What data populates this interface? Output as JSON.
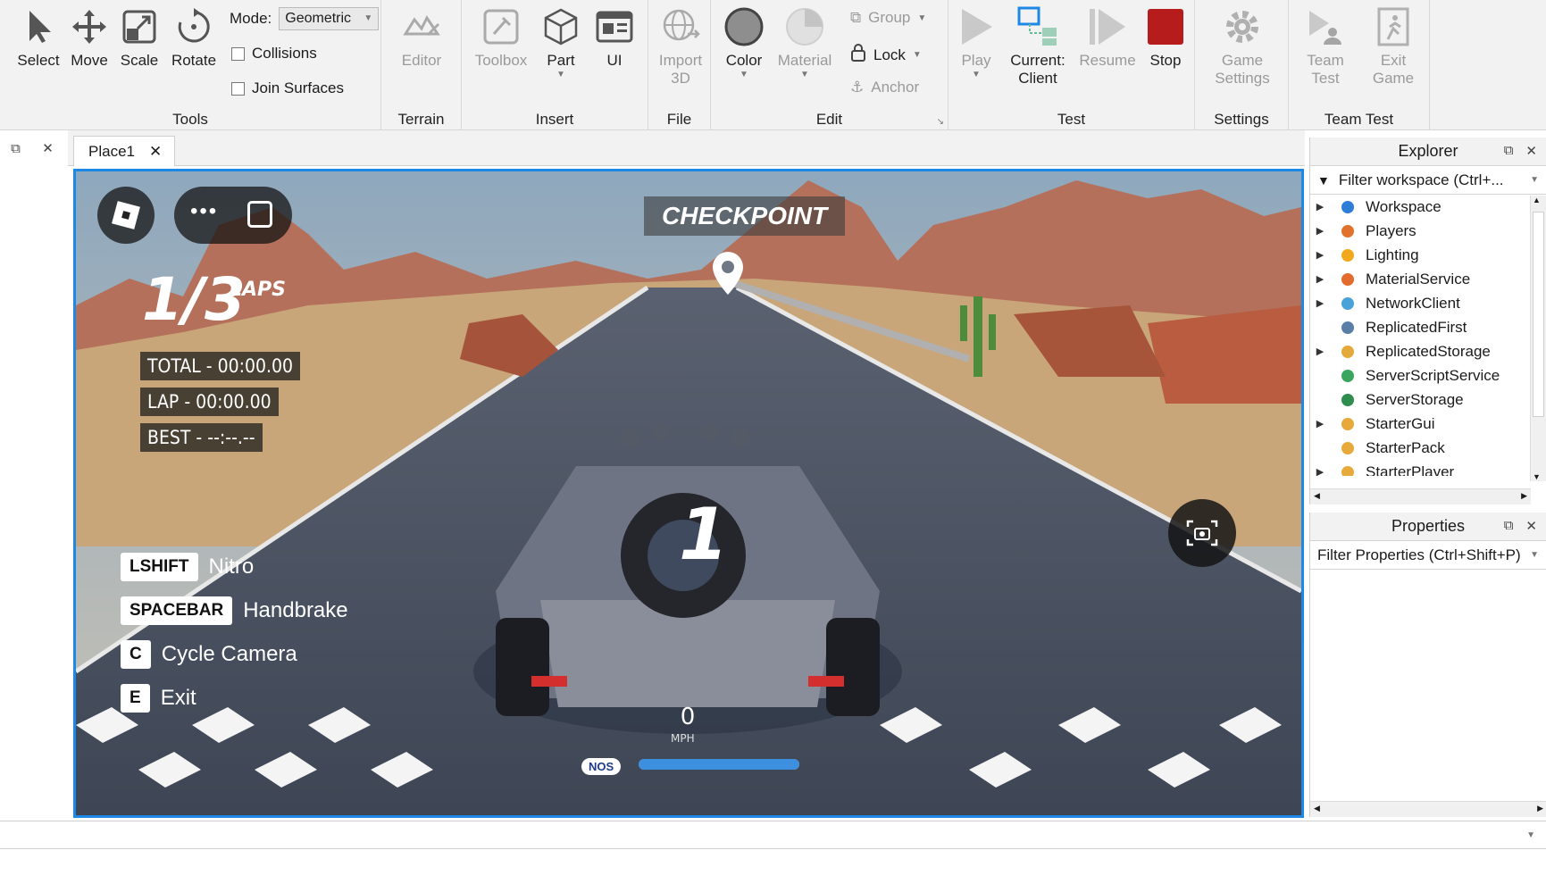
{
  "ribbon": {
    "tools": {
      "label": "Tools",
      "select": "Select",
      "move": "Move",
      "scale": "Scale",
      "rotate": "Rotate",
      "mode_label": "Mode:",
      "mode_value": "Geometric",
      "collisions": "Collisions",
      "join_surfaces": "Join Surfaces"
    },
    "terrain": {
      "label": "Terrain",
      "editor": "Editor"
    },
    "insert": {
      "label": "Insert",
      "toolbox": "Toolbox",
      "part": "Part",
      "ui": "UI"
    },
    "file": {
      "label": "File",
      "import_line1": "Import",
      "import_line2": "3D"
    },
    "edit": {
      "label": "Edit",
      "color": "Color",
      "material": "Material",
      "group": "Group",
      "lock": "Lock",
      "anchor": "Anchor"
    },
    "test": {
      "label": "Test",
      "play": "Play",
      "current_line1": "Current:",
      "current_line2": "Client",
      "resume": "Resume",
      "stop": "Stop"
    },
    "settings": {
      "label": "Settings",
      "game_line1": "Game",
      "game_line2": "Settings"
    },
    "team_test": {
      "label": "Team Test",
      "team_line1": "Team",
      "team_line2": "Test",
      "exit_line1": "Exit",
      "exit_line2": "Game"
    }
  },
  "tabs": {
    "place": "Place1"
  },
  "hud": {
    "checkpoint": "CHECKPOINT",
    "laps_value": "1/3",
    "laps_label": "LAPS",
    "total": "TOTAL - 00:00.00",
    "lap": "LAP - 00:00.00",
    "best": "BEST - --:--.--",
    "position": "1",
    "speed": "0",
    "speed_unit": "MPH",
    "nos": "NOS",
    "nos_level": 1.0,
    "keys": [
      {
        "key": "LSHIFT",
        "action": "Nitro"
      },
      {
        "key": "SPACEBAR",
        "action": "Handbrake"
      },
      {
        "key": "C",
        "action": "Cycle Camera"
      },
      {
        "key": "E",
        "action": "Exit"
      }
    ]
  },
  "explorer": {
    "title": "Explorer",
    "filter": "Filter workspace (Ctrl+...",
    "items": [
      {
        "label": "Workspace",
        "arrow": true
      },
      {
        "label": "Players",
        "arrow": true
      },
      {
        "label": "Lighting",
        "arrow": true
      },
      {
        "label": "MaterialService",
        "arrow": true
      },
      {
        "label": "NetworkClient",
        "arrow": true
      },
      {
        "label": "ReplicatedFirst",
        "arrow": false
      },
      {
        "label": "ReplicatedStorage",
        "arrow": true
      },
      {
        "label": "ServerScriptService",
        "arrow": false
      },
      {
        "label": "ServerStorage",
        "arrow": false
      },
      {
        "label": "StarterGui",
        "arrow": true
      },
      {
        "label": "StarterPack",
        "arrow": false
      },
      {
        "label": "StarterPlayer",
        "arrow": true
      }
    ]
  },
  "properties": {
    "title": "Properties",
    "filter": "Filter Properties (Ctrl+Shift+P)"
  },
  "colors": {
    "accent": "#1e88e5",
    "stop": "#b71c1c",
    "panel_bg": "#f2f2f2"
  }
}
